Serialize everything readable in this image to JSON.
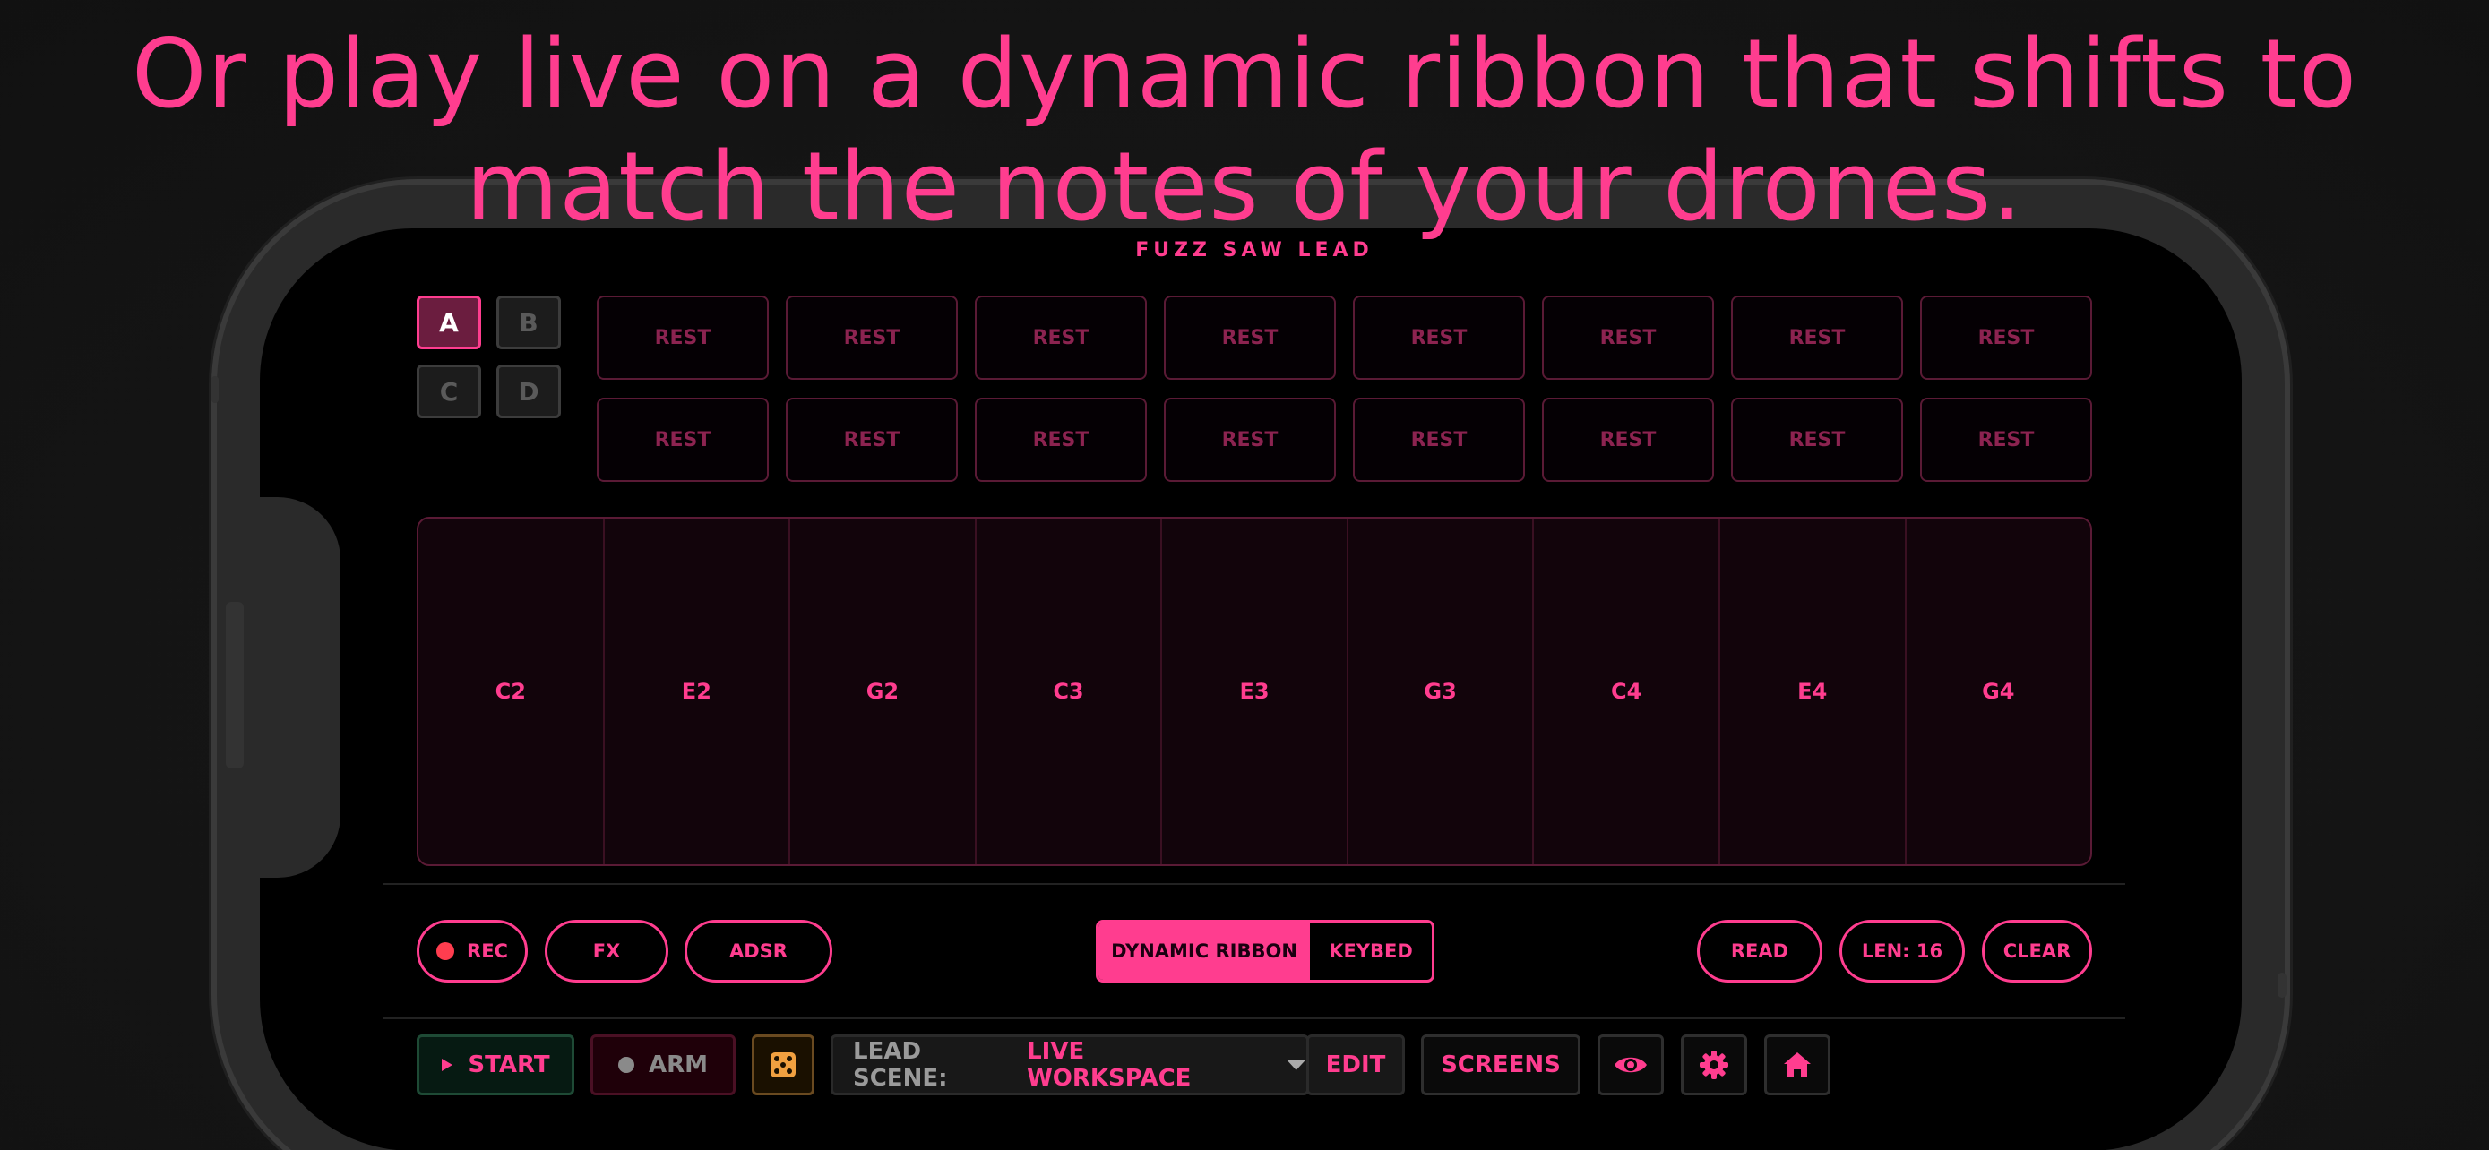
{
  "headline": {
    "line1": "Or play live on a dynamic ribbon that shifts to",
    "line2": "match the notes of your drones."
  },
  "screen_title": "FUZZ SAW LEAD",
  "patterns": [
    {
      "label": "A",
      "active": true
    },
    {
      "label": "B",
      "active": false
    },
    {
      "label": "C",
      "active": false
    },
    {
      "label": "D",
      "active": false
    }
  ],
  "steps": [
    "REST",
    "REST",
    "REST",
    "REST",
    "REST",
    "REST",
    "REST",
    "REST",
    "REST",
    "REST",
    "REST",
    "REST",
    "REST",
    "REST",
    "REST",
    "REST"
  ],
  "ribbon_notes": [
    "C2",
    "E2",
    "G2",
    "C3",
    "E3",
    "G3",
    "C4",
    "E4",
    "G4"
  ],
  "controls": {
    "rec": "REC",
    "fx": "FX",
    "adsr": "ADSR",
    "mode_on": "DYNAMIC RIBBON",
    "mode_off": "KEYBED",
    "read": "READ",
    "len": "LEN: 16",
    "clear": "CLEAR"
  },
  "bottom_bar": {
    "start": "START",
    "arm": "ARM",
    "scene_label": "LEAD SCENE:",
    "scene_value": "LIVE WORKSPACE",
    "edit": "EDIT",
    "screens": "SCREENS"
  },
  "icons": [
    "play-icon",
    "dot-icon",
    "dice-icon",
    "chevron-down-icon",
    "eye-icon",
    "gear-icon",
    "home-icon"
  ],
  "colors": {
    "accent": "#ff3d8f",
    "background": "#000000",
    "dice": "#f0a040"
  }
}
